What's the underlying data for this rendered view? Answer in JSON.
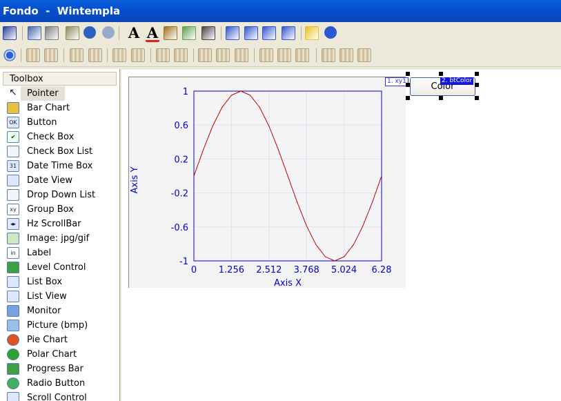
{
  "window": {
    "title": "Fondo  -  Wintempla"
  },
  "toolbar1": [
    "save-icon",
    "copy-icon",
    "cut-icon",
    "paste-icon",
    "undo-icon",
    "redo-icon",
    "font-icon",
    "font-color-icon",
    "fill-color-icon",
    "line-color-icon",
    "paint-icon",
    "bring-front-icon",
    "send-back-icon",
    "bring-forward-icon",
    "send-backward-icon",
    "check-icon",
    "help-icon"
  ],
  "toolbar1_text": {
    "font_glyph": "A",
    "font_color_glyph": "A"
  },
  "toolbar2": [
    "asterisk-icon",
    "space-horiz-icon",
    "space-horiz-equal-icon",
    "space-vert-icon",
    "space-vert-equal-icon",
    "center-icon",
    "expand-icon",
    "same-width-icon",
    "same-width-alt-icon",
    "same-height-icon",
    "same-height-alt-icon",
    "grid-icon",
    "align-top-icon",
    "align-middle-icon",
    "align-bottom-icon",
    "align-left-icon",
    "align-center-icon",
    "align-right-icon"
  ],
  "toolbox": {
    "title": "Toolbox",
    "items": [
      {
        "label": "Pointer",
        "icon": "pointer-icon",
        "selected": true
      },
      {
        "label": "Bar Chart",
        "icon": "bar-chart-icon"
      },
      {
        "label": "Button",
        "icon": "button-icon",
        "glyph": "OK"
      },
      {
        "label": "Check Box",
        "icon": "check-box-icon",
        "glyph": "✔"
      },
      {
        "label": "Check Box List",
        "icon": "check-box-list-icon"
      },
      {
        "label": "Date Time Box",
        "icon": "calendar-icon",
        "glyph": "31"
      },
      {
        "label": "Date View",
        "icon": "date-view-icon"
      },
      {
        "label": "Drop Down List",
        "icon": "drop-down-icon"
      },
      {
        "label": "Group Box",
        "icon": "group-box-icon",
        "glyph": "xy"
      },
      {
        "label": "Hz ScrollBar",
        "icon": "scrollbar-icon",
        "glyph": "◂▸"
      },
      {
        "label": "Image: jpg/gif",
        "icon": "image-icon"
      },
      {
        "label": "Label",
        "icon": "label-icon",
        "glyph": "in"
      },
      {
        "label": "Level Control",
        "icon": "level-icon"
      },
      {
        "label": "List Box",
        "icon": "list-box-icon"
      },
      {
        "label": "List View",
        "icon": "list-view-icon"
      },
      {
        "label": "Monitor",
        "icon": "monitor-icon"
      },
      {
        "label": "Picture (bmp)",
        "icon": "picture-icon"
      },
      {
        "label": "Pie Chart",
        "icon": "pie-chart-icon"
      },
      {
        "label": "Polar Chart",
        "icon": "polar-chart-icon"
      },
      {
        "label": "Progress Bar",
        "icon": "progress-bar-icon"
      },
      {
        "label": "Radio Button",
        "icon": "radio-button-icon"
      },
      {
        "label": "Scroll Control",
        "icon": "scroll-control-icon"
      }
    ]
  },
  "canvas": {
    "xy_tag": "1. xy1",
    "button": {
      "label": "Color",
      "tag": "2. btColor"
    }
  },
  "colors": {
    "title_bar": "#0450d0",
    "axis_blue": "#0000cc",
    "curve_red": "#c00000",
    "tag_blue": "#1515e0"
  },
  "chart_data": {
    "type": "line",
    "xlabel": "Axis X",
    "ylabel": "Axis Y",
    "xlim": [
      0,
      6.28
    ],
    "ylim": [
      -1,
      1
    ],
    "x_ticks": [
      "0",
      "1.256",
      "2.512",
      "3.768",
      "5.024",
      "6.28"
    ],
    "y_ticks": [
      "1",
      "0.6",
      "0.2",
      "-0.2",
      "-0.6",
      "-1"
    ],
    "series": [
      {
        "x": [
          0,
          0.314,
          0.628,
          0.942,
          1.256,
          1.571,
          1.885,
          2.199,
          2.513,
          2.827,
          3.142,
          3.456,
          3.77,
          4.084,
          4.398,
          4.712,
          5.027,
          5.341,
          5.655,
          5.969,
          6.28
        ],
        "values": [
          0,
          0.309,
          0.588,
          0.809,
          0.951,
          1,
          0.951,
          0.809,
          0.588,
          0.309,
          0,
          -0.309,
          -0.588,
          -0.809,
          -0.951,
          -1,
          -0.951,
          -0.809,
          -0.588,
          -0.309,
          0
        ]
      }
    ],
    "grid": true
  }
}
